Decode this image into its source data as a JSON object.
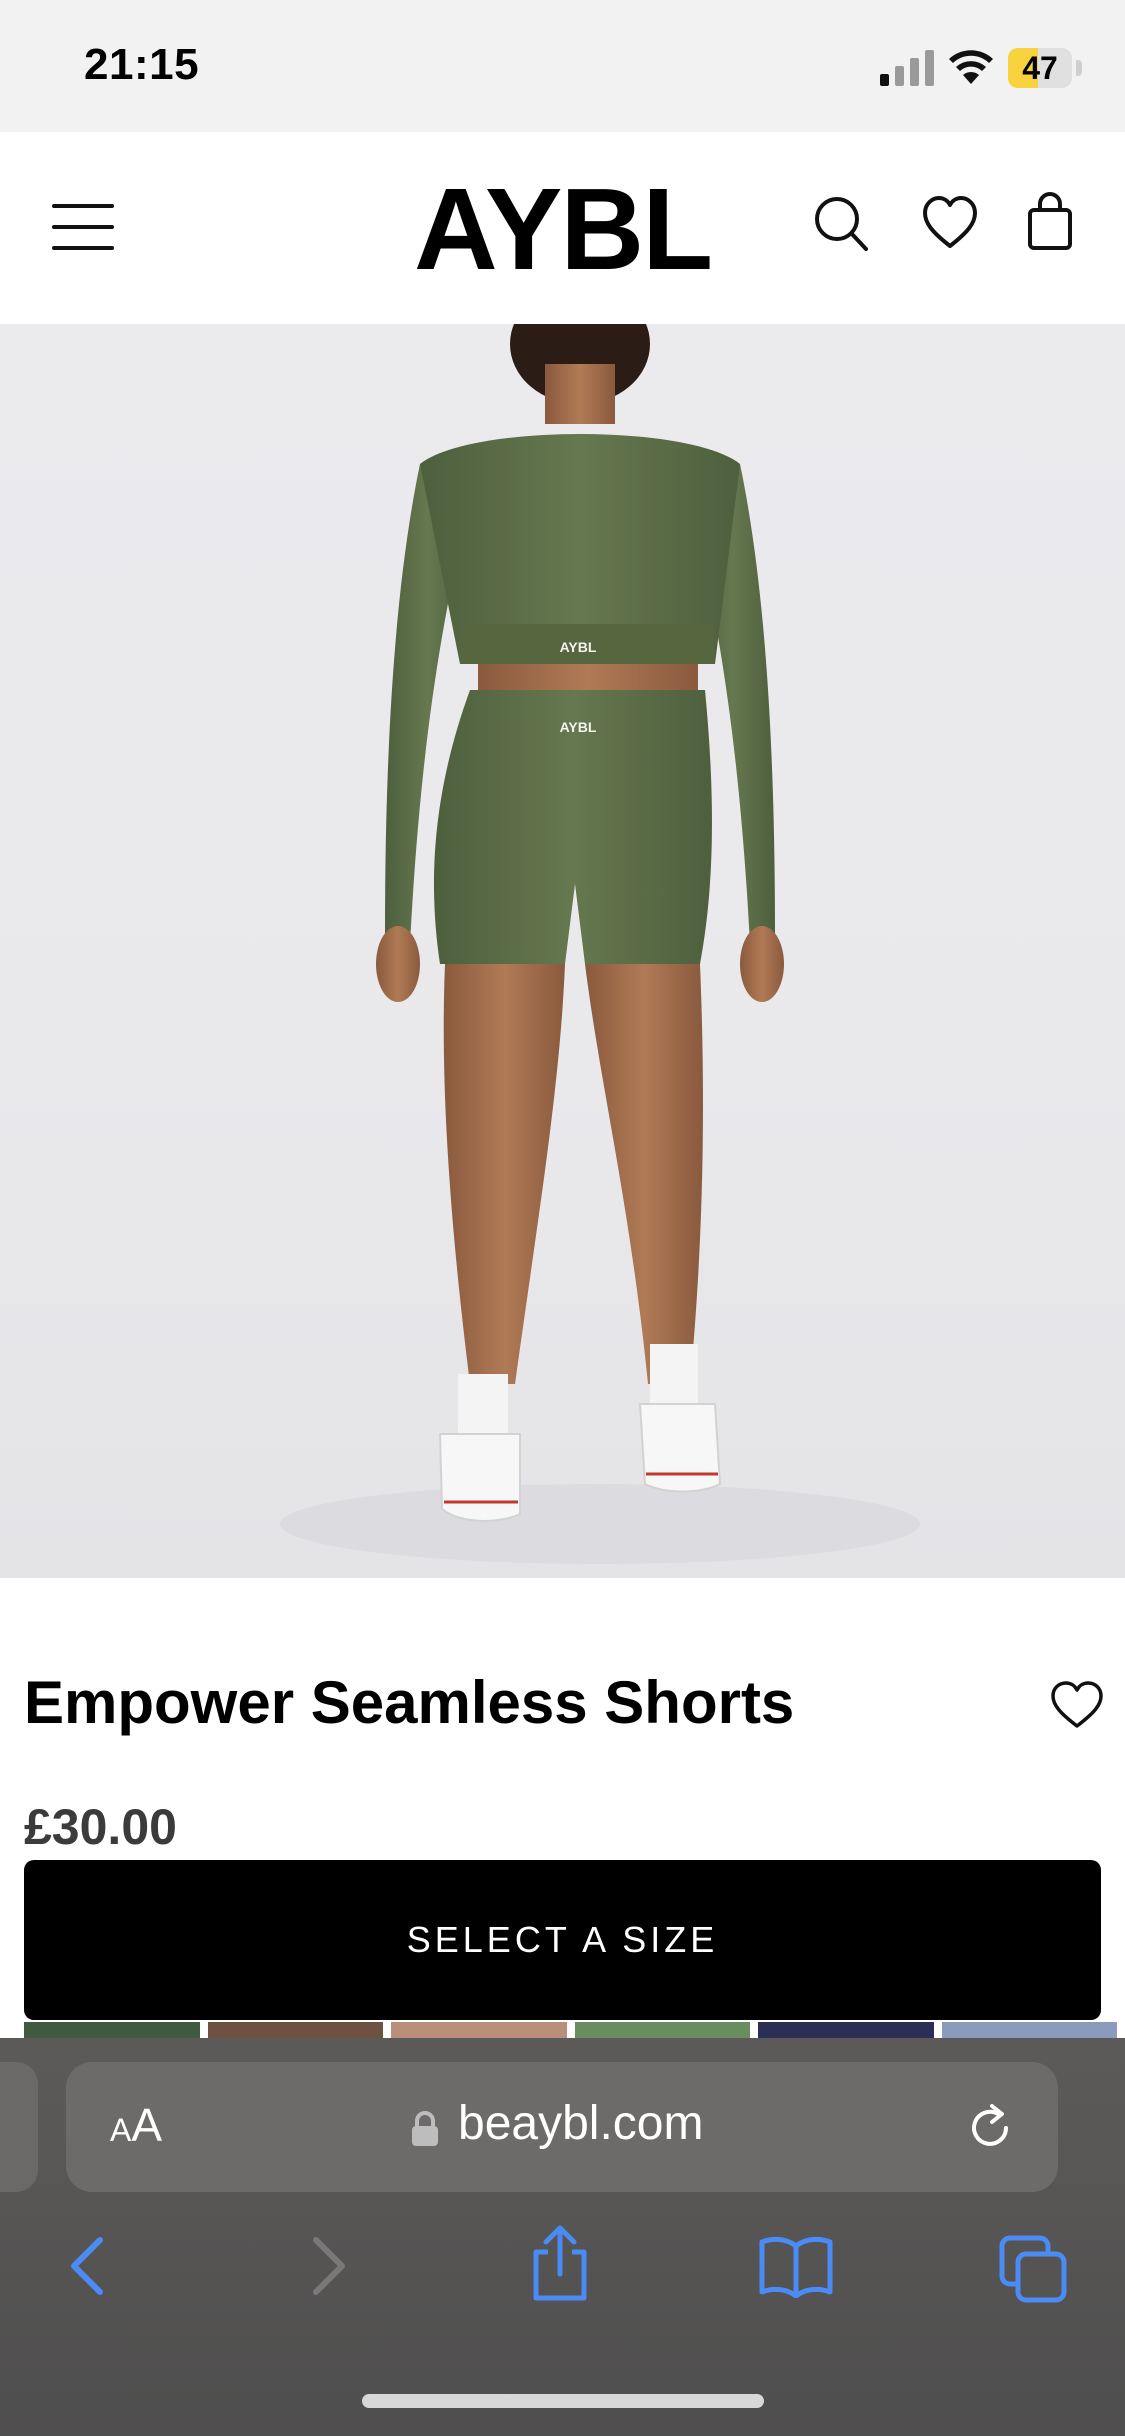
{
  "status_bar": {
    "time": "21:15",
    "battery_level": "47",
    "battery_fill_fraction": 0.47
  },
  "header": {
    "logo": "AYBL",
    "menu_icon": "hamburger-menu-icon",
    "search_icon": "search-icon",
    "wishlist_icon": "heart-icon",
    "bag_icon": "shopping-bag-icon"
  },
  "product": {
    "image_alt": "Back view of model wearing olive green Empower Seamless Shorts and cropped top",
    "name": "Empower Seamless Shorts",
    "price": "£30.00",
    "cta_label": "SELECT A SIZE",
    "accent_color": "#5a6b47",
    "swatch_colors": [
      "#3f5a3f",
      "#6e5140",
      "#b98f7a",
      "#6a8d5f",
      "#2b2f55",
      "#8a9bbd"
    ]
  },
  "browser": {
    "text_size_label_small": "A",
    "text_size_label_large": "A",
    "domain": "beaybl.com",
    "back_icon": "chevron-left-icon",
    "forward_icon": "chevron-right-icon",
    "share_icon": "share-icon",
    "bookmarks_icon": "book-icon",
    "tabs_icon": "tabs-icon",
    "accent": "#3b82f6"
  }
}
